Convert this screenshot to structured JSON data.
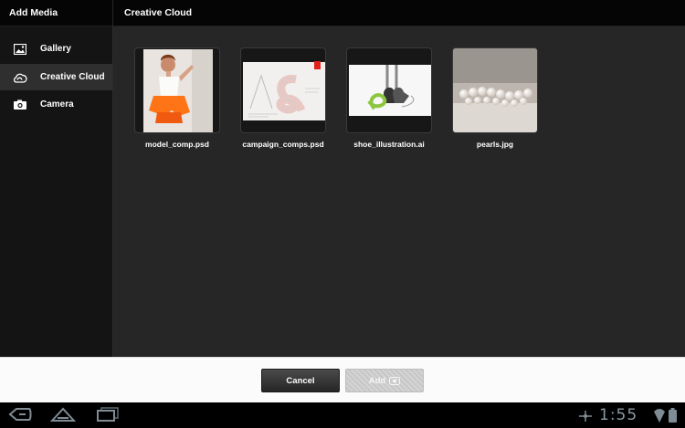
{
  "header": {
    "left_title": "Add Media",
    "right_title": "Creative Cloud"
  },
  "sidebar": {
    "items": [
      {
        "label": "Gallery",
        "icon": "image-icon",
        "selected": false
      },
      {
        "label": "Creative Cloud",
        "icon": "creative-cloud-icon",
        "selected": true
      },
      {
        "label": "Camera",
        "icon": "camera-icon",
        "selected": false
      }
    ]
  },
  "files": [
    {
      "name": "model_comp.psd"
    },
    {
      "name": "campaign_comps.psd"
    },
    {
      "name": "shoe_illustration.ai"
    },
    {
      "name": "pearls.jpg"
    }
  ],
  "footer": {
    "cancel_label": "Cancel",
    "add_label": "Add"
  },
  "system_bar": {
    "time": "1:55"
  },
  "colors": {
    "content_bg": "#262626",
    "sidebar_bg": "#141414",
    "selected_bg": "#2f2f2f",
    "footer_bg": "#fbfbfb",
    "clock": "#8a9aa2"
  }
}
